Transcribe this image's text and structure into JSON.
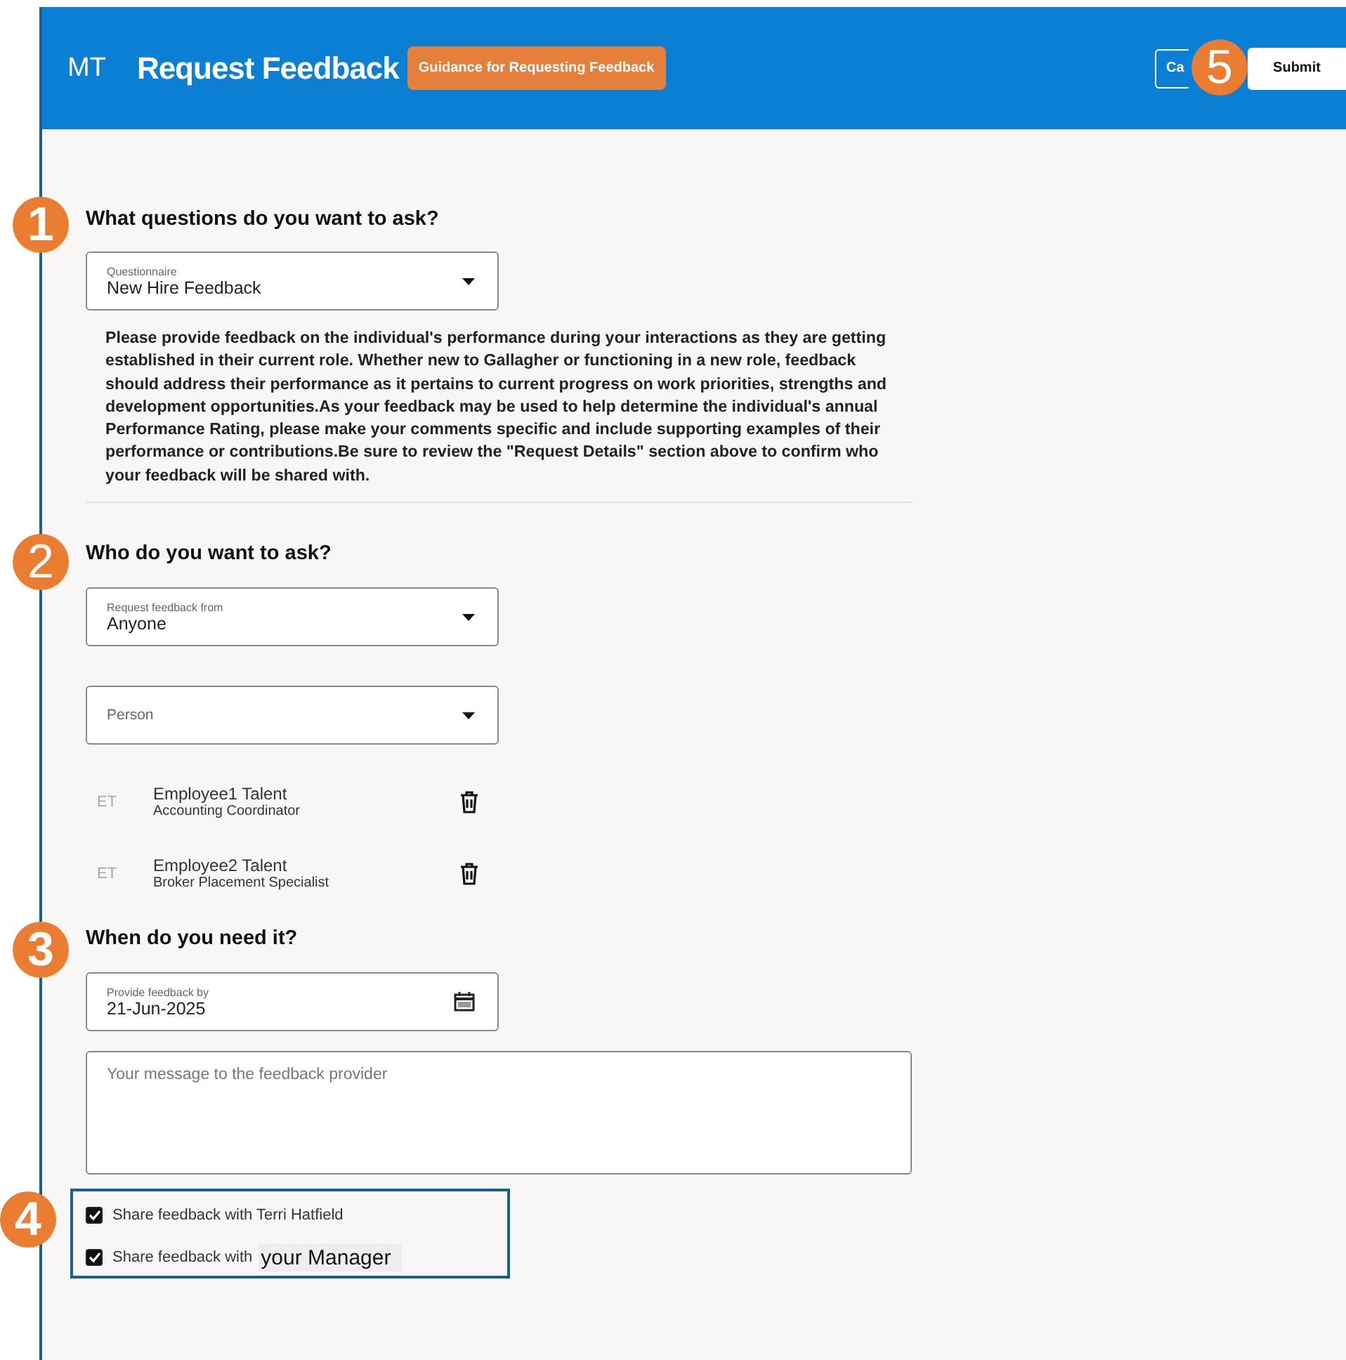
{
  "header": {
    "initials": "MT",
    "title": "Request Feedback",
    "guidance_button": "Guidance for Requesting Feedback",
    "cancel_button": "Ca",
    "submit_button": "Submit"
  },
  "callouts": [
    "1",
    "2",
    "3",
    "4",
    "5"
  ],
  "questions": {
    "heading": "What questions do you want to ask?",
    "questionnaire": {
      "label": "Questionnaire",
      "value": "New Hire Feedback"
    },
    "description": "Please provide feedback on the individual's performance during your interactions as they are getting established in their current role. Whether new to Gallagher or functioning in a new role, feedback should address their performance as it pertains to current progress on work priorities, strengths and development opportunities.As your feedback may be used to help determine the individual's annual Performance Rating, please make your comments specific and include supporting examples of their performance or contributions.Be sure to review the \"Request Details\" section above to confirm who your feedback will be shared with."
  },
  "who": {
    "heading": "Who do you want to ask?",
    "request_from": {
      "label": "Request feedback from",
      "value": "Anyone"
    },
    "person": {
      "placeholder": "Person"
    },
    "people": [
      {
        "initials": "ET",
        "name": "Employee1 Talent",
        "role": "Accounting Coordinator"
      },
      {
        "initials": "ET",
        "name": "Employee2 Talent",
        "role": "Broker Placement Specialist"
      }
    ]
  },
  "when": {
    "heading": "When do you need it?",
    "date": {
      "label": "Provide feedback by",
      "value": "21-Jun-2025"
    },
    "message": {
      "placeholder": "Your message to the feedback provider"
    }
  },
  "sharing": [
    {
      "label": "Share feedback with Terri Hatfield",
      "checked": true
    },
    {
      "label": "Share feedback with",
      "extra": "your Manager",
      "checked": true
    }
  ]
}
